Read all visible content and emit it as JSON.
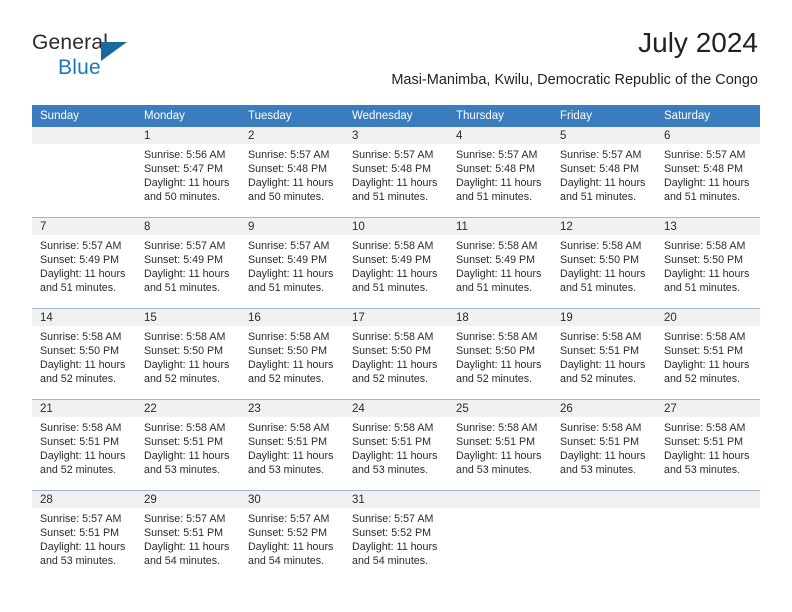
{
  "logo": {
    "word_top": "General",
    "word_bottom": "Blue",
    "triangle_color": "#19699f",
    "blue_text_color": "#1878be"
  },
  "header": {
    "title": "July 2024",
    "subtitle": "Masi-Manimba, Kwilu, Democratic Republic of the Congo"
  },
  "theme": {
    "header_bar": "#3a7cbe",
    "date_band": "#f1f1f1",
    "grid_line": "#9fb8d0",
    "text": "#2b2b2b"
  },
  "calendar": {
    "weekday_headers": [
      "Sunday",
      "Monday",
      "Tuesday",
      "Wednesday",
      "Thursday",
      "Friday",
      "Saturday"
    ],
    "weeks": [
      [
        {
          "day": "",
          "empty": true,
          "sunrise": "",
          "sunset": "",
          "daylight": ""
        },
        {
          "day": "1",
          "sunrise": "Sunrise: 5:56 AM",
          "sunset": "Sunset: 5:47 PM",
          "daylight": "Daylight: 11 hours and 50 minutes."
        },
        {
          "day": "2",
          "sunrise": "Sunrise: 5:57 AM",
          "sunset": "Sunset: 5:48 PM",
          "daylight": "Daylight: 11 hours and 50 minutes."
        },
        {
          "day": "3",
          "sunrise": "Sunrise: 5:57 AM",
          "sunset": "Sunset: 5:48 PM",
          "daylight": "Daylight: 11 hours and 51 minutes."
        },
        {
          "day": "4",
          "sunrise": "Sunrise: 5:57 AM",
          "sunset": "Sunset: 5:48 PM",
          "daylight": "Daylight: 11 hours and 51 minutes."
        },
        {
          "day": "5",
          "sunrise": "Sunrise: 5:57 AM",
          "sunset": "Sunset: 5:48 PM",
          "daylight": "Daylight: 11 hours and 51 minutes."
        },
        {
          "day": "6",
          "sunrise": "Sunrise: 5:57 AM",
          "sunset": "Sunset: 5:48 PM",
          "daylight": "Daylight: 11 hours and 51 minutes."
        }
      ],
      [
        {
          "day": "7",
          "sunrise": "Sunrise: 5:57 AM",
          "sunset": "Sunset: 5:49 PM",
          "daylight": "Daylight: 11 hours and 51 minutes."
        },
        {
          "day": "8",
          "sunrise": "Sunrise: 5:57 AM",
          "sunset": "Sunset: 5:49 PM",
          "daylight": "Daylight: 11 hours and 51 minutes."
        },
        {
          "day": "9",
          "sunrise": "Sunrise: 5:57 AM",
          "sunset": "Sunset: 5:49 PM",
          "daylight": "Daylight: 11 hours and 51 minutes."
        },
        {
          "day": "10",
          "sunrise": "Sunrise: 5:58 AM",
          "sunset": "Sunset: 5:49 PM",
          "daylight": "Daylight: 11 hours and 51 minutes."
        },
        {
          "day": "11",
          "sunrise": "Sunrise: 5:58 AM",
          "sunset": "Sunset: 5:49 PM",
          "daylight": "Daylight: 11 hours and 51 minutes."
        },
        {
          "day": "12",
          "sunrise": "Sunrise: 5:58 AM",
          "sunset": "Sunset: 5:50 PM",
          "daylight": "Daylight: 11 hours and 51 minutes."
        },
        {
          "day": "13",
          "sunrise": "Sunrise: 5:58 AM",
          "sunset": "Sunset: 5:50 PM",
          "daylight": "Daylight: 11 hours and 51 minutes."
        }
      ],
      [
        {
          "day": "14",
          "sunrise": "Sunrise: 5:58 AM",
          "sunset": "Sunset: 5:50 PM",
          "daylight": "Daylight: 11 hours and 52 minutes."
        },
        {
          "day": "15",
          "sunrise": "Sunrise: 5:58 AM",
          "sunset": "Sunset: 5:50 PM",
          "daylight": "Daylight: 11 hours and 52 minutes."
        },
        {
          "day": "16",
          "sunrise": "Sunrise: 5:58 AM",
          "sunset": "Sunset: 5:50 PM",
          "daylight": "Daylight: 11 hours and 52 minutes."
        },
        {
          "day": "17",
          "sunrise": "Sunrise: 5:58 AM",
          "sunset": "Sunset: 5:50 PM",
          "daylight": "Daylight: 11 hours and 52 minutes."
        },
        {
          "day": "18",
          "sunrise": "Sunrise: 5:58 AM",
          "sunset": "Sunset: 5:50 PM",
          "daylight": "Daylight: 11 hours and 52 minutes."
        },
        {
          "day": "19",
          "sunrise": "Sunrise: 5:58 AM",
          "sunset": "Sunset: 5:51 PM",
          "daylight": "Daylight: 11 hours and 52 minutes."
        },
        {
          "day": "20",
          "sunrise": "Sunrise: 5:58 AM",
          "sunset": "Sunset: 5:51 PM",
          "daylight": "Daylight: 11 hours and 52 minutes."
        }
      ],
      [
        {
          "day": "21",
          "sunrise": "Sunrise: 5:58 AM",
          "sunset": "Sunset: 5:51 PM",
          "daylight": "Daylight: 11 hours and 52 minutes."
        },
        {
          "day": "22",
          "sunrise": "Sunrise: 5:58 AM",
          "sunset": "Sunset: 5:51 PM",
          "daylight": "Daylight: 11 hours and 53 minutes."
        },
        {
          "day": "23",
          "sunrise": "Sunrise: 5:58 AM",
          "sunset": "Sunset: 5:51 PM",
          "daylight": "Daylight: 11 hours and 53 minutes."
        },
        {
          "day": "24",
          "sunrise": "Sunrise: 5:58 AM",
          "sunset": "Sunset: 5:51 PM",
          "daylight": "Daylight: 11 hours and 53 minutes."
        },
        {
          "day": "25",
          "sunrise": "Sunrise: 5:58 AM",
          "sunset": "Sunset: 5:51 PM",
          "daylight": "Daylight: 11 hours and 53 minutes."
        },
        {
          "day": "26",
          "sunrise": "Sunrise: 5:58 AM",
          "sunset": "Sunset: 5:51 PM",
          "daylight": "Daylight: 11 hours and 53 minutes."
        },
        {
          "day": "27",
          "sunrise": "Sunrise: 5:58 AM",
          "sunset": "Sunset: 5:51 PM",
          "daylight": "Daylight: 11 hours and 53 minutes."
        }
      ],
      [
        {
          "day": "28",
          "sunrise": "Sunrise: 5:57 AM",
          "sunset": "Sunset: 5:51 PM",
          "daylight": "Daylight: 11 hours and 53 minutes."
        },
        {
          "day": "29",
          "sunrise": "Sunrise: 5:57 AM",
          "sunset": "Sunset: 5:51 PM",
          "daylight": "Daylight: 11 hours and 54 minutes."
        },
        {
          "day": "30",
          "sunrise": "Sunrise: 5:57 AM",
          "sunset": "Sunset: 5:52 PM",
          "daylight": "Daylight: 11 hours and 54 minutes."
        },
        {
          "day": "31",
          "sunrise": "Sunrise: 5:57 AM",
          "sunset": "Sunset: 5:52 PM",
          "daylight": "Daylight: 11 hours and 54 minutes."
        },
        {
          "day": "",
          "empty": true,
          "sunrise": "",
          "sunset": "",
          "daylight": ""
        },
        {
          "day": "",
          "empty": true,
          "sunrise": "",
          "sunset": "",
          "daylight": ""
        },
        {
          "day": "",
          "empty": true,
          "sunrise": "",
          "sunset": "",
          "daylight": ""
        }
      ]
    ]
  }
}
